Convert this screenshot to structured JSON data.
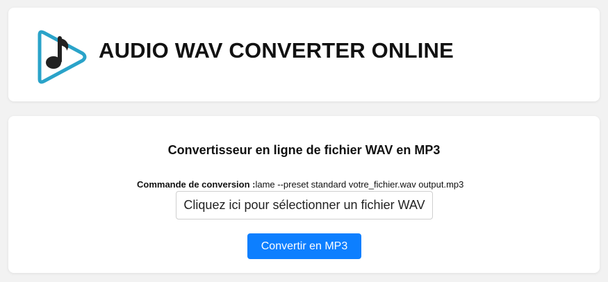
{
  "header": {
    "title": "AUDIO WAV CONVERTER ONLINE",
    "logo_icon": "play-music-note-icon",
    "logo_colors": {
      "outline": "#2aa3c9",
      "note": "#222222"
    }
  },
  "converter": {
    "title": "Convertisseur en ligne de fichier WAV en MP3",
    "command_label": "Commande de conversion :",
    "command_value": "lame --preset standard votre_fichier.wav output.mp3",
    "file_picker_label": "Cliquez ici pour sélectionner un fichier WAV",
    "convert_button_label": "Convertir en MP3",
    "accent_color": "#0d7fff"
  }
}
